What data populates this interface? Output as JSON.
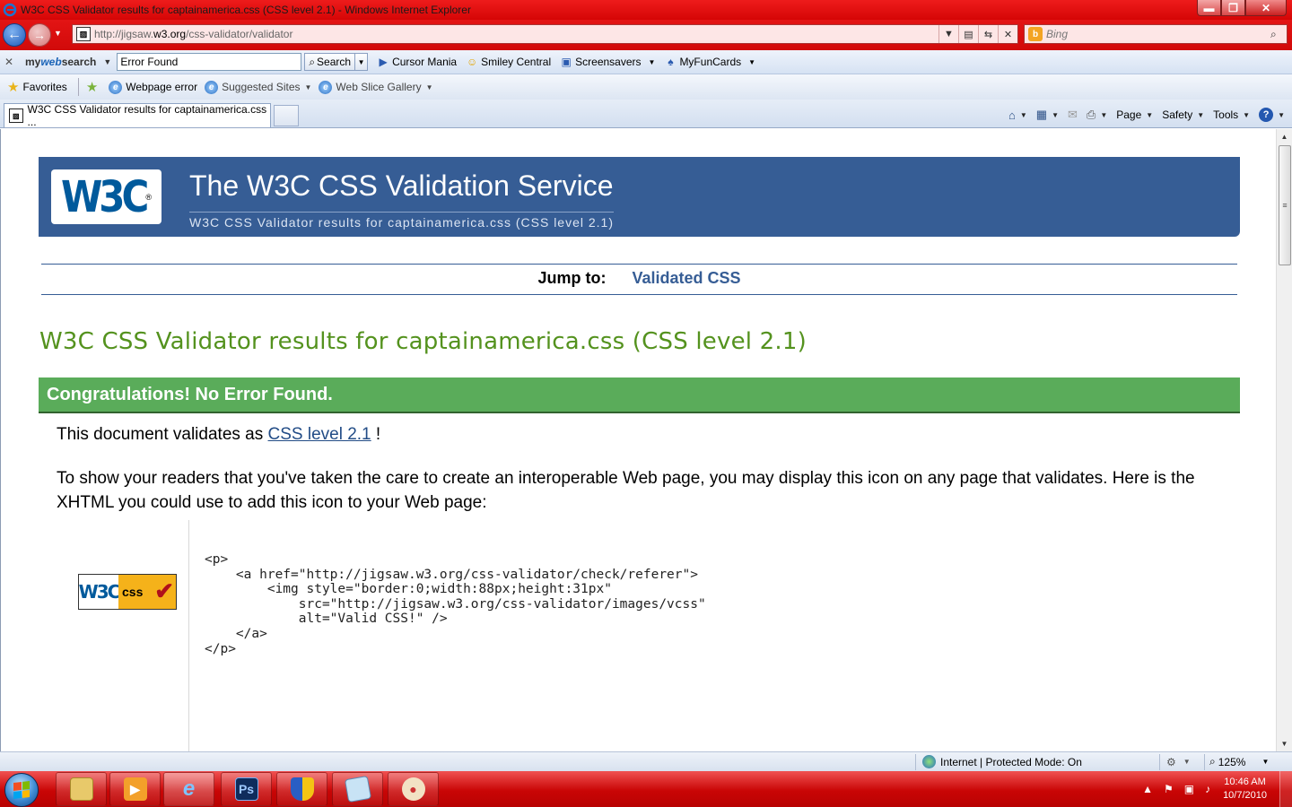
{
  "window": {
    "title": "W3C CSS Validator results for captainamerica.css (CSS level 2.1) - Windows Internet Explorer",
    "min_glyph": "▬",
    "max_glyph": "❐",
    "close_glyph": "✕"
  },
  "address_bar": {
    "url_prefix": "http://jigsaw.",
    "url_domain": "w3.org",
    "url_suffix": "/css-validator/validator",
    "search_placeholder": "Bing",
    "search_icon": "search-icon"
  },
  "mywebsearch": {
    "brand_my": "my",
    "brand_web": "web",
    "brand_search": "search",
    "search_value": "Error Found",
    "search_button": "Search",
    "tools": [
      {
        "label": "Cursor Mania",
        "icon": "cursor-icon"
      },
      {
        "label": "Smiley Central",
        "icon": "smiley-icon"
      },
      {
        "label": "Screensavers",
        "icon": "monitor-icon"
      },
      {
        "label": "MyFunCards",
        "icon": "card-icon"
      }
    ]
  },
  "favorites_bar": {
    "favorites_label": "Favorites",
    "items": [
      {
        "label": "Webpage error"
      },
      {
        "label": "Suggested Sites"
      },
      {
        "label": "Web Slice Gallery"
      }
    ]
  },
  "tabs": [
    {
      "label": "W3C CSS Validator results for captainamerica.css ...",
      "active": true
    }
  ],
  "command_bar": {
    "page": "Page",
    "safety": "Safety",
    "tools": "Tools",
    "help": "?"
  },
  "page": {
    "banner_logo": "W3C",
    "banner_title": "The W3C CSS Validation Service",
    "banner_subtitle": "W3C CSS Validator results for captainamerica.css (CSS level 2.1)",
    "jump_label": "Jump to:",
    "jump_link": "Validated CSS",
    "results_title": "W3C CSS Validator results for captainamerica.css (CSS level 2.1)",
    "congrats": "Congratulations! No Error Found.",
    "validates_prefix": "This document validates as ",
    "validates_link": "CSS level 2.1",
    "validates_suffix": " !",
    "icon_paragraph": "To show your readers that you've taken the care to create an interoperable Web page, you may display this icon on any page that validates. Here is the XHTML you could use to add this icon to your Web page:",
    "badge_w3c": "W3C",
    "badge_css": "css",
    "code": "<p>\n    <a href=\"http://jigsaw.w3.org/css-validator/check/referer\">\n        <img style=\"border:0;width:88px;height:31px\"\n            src=\"http://jigsaw.w3.org/css-validator/images/vcss\"\n            alt=\"Valid CSS!\" />\n    </a>\n</p>"
  },
  "status_bar": {
    "zone": "Internet | Protected Mode: On",
    "zoom": "125%"
  },
  "taskbar": {
    "time": "10:46 AM",
    "date": "10/7/2010",
    "ps_label": "Ps"
  },
  "colors": {
    "banner": "#365d95",
    "results_title": "#54921e",
    "congrats": "#5aac5a",
    "chrome_red": "#d50606"
  }
}
